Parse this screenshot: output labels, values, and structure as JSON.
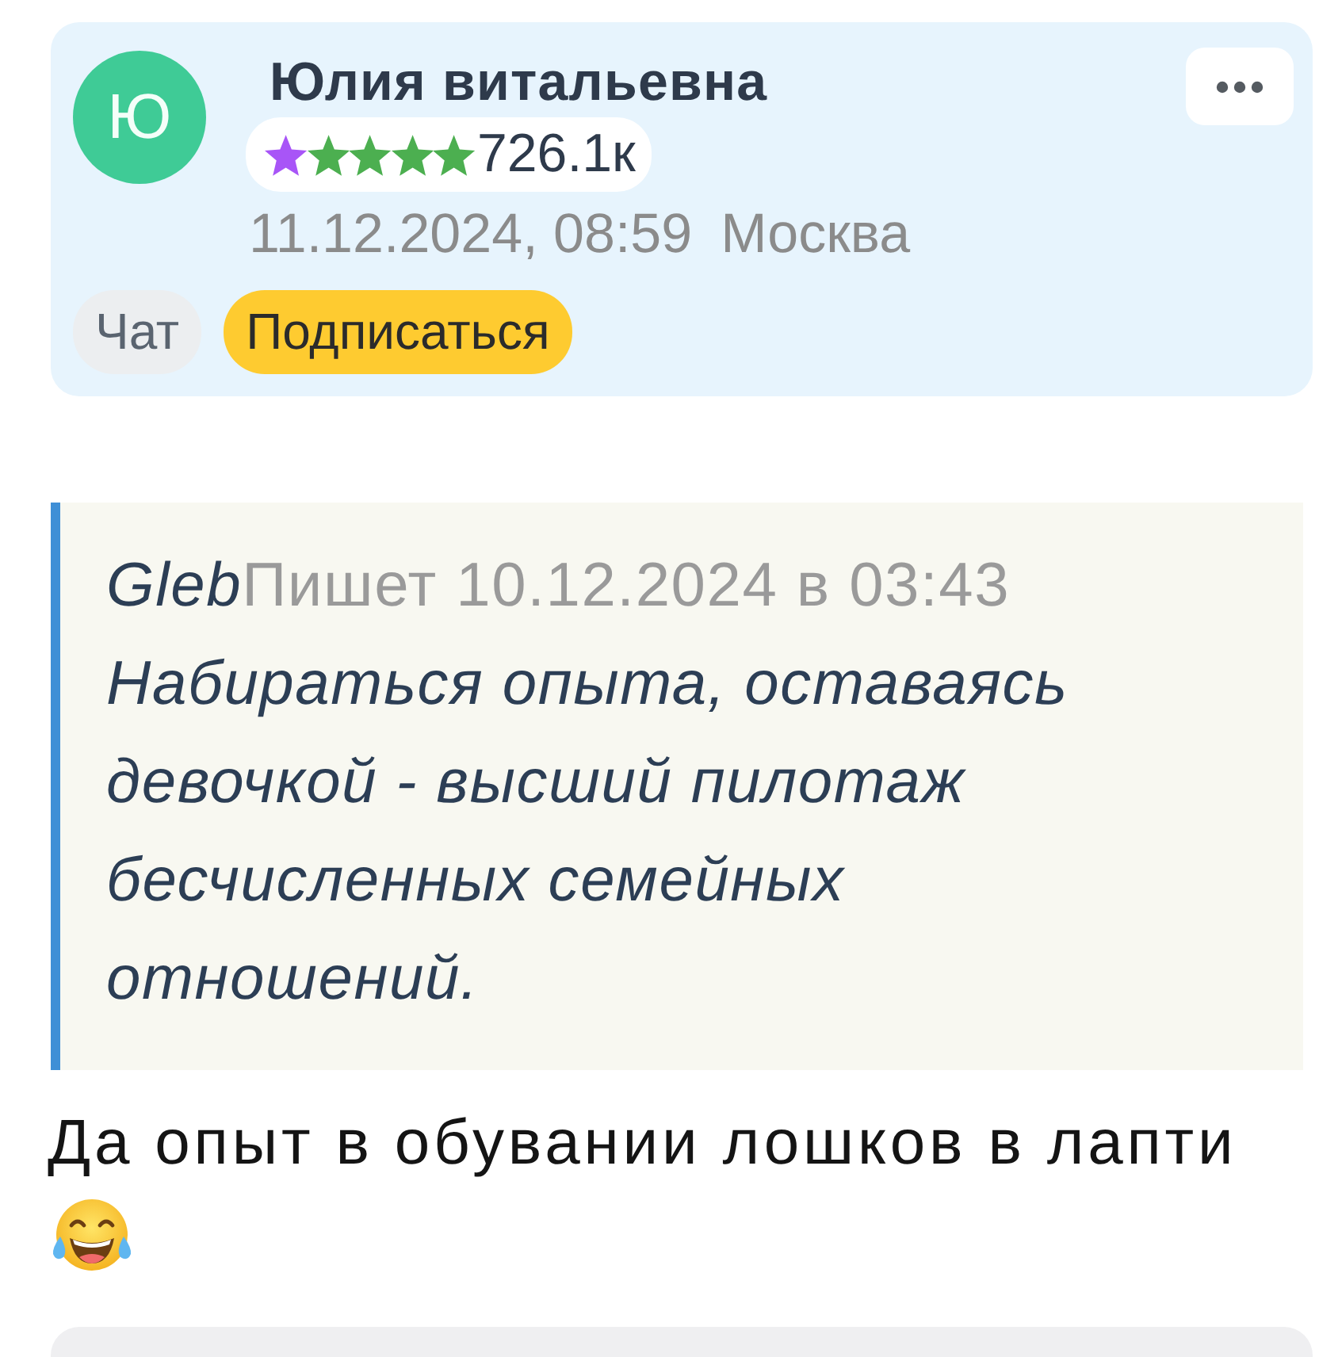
{
  "author": {
    "avatar_initial": "Ю",
    "name": "Юлия витальевна",
    "rating": {
      "star_items": [
        {
          "color": "#a855f7"
        },
        {
          "color": "#4caf50"
        },
        {
          "color": "#4caf50"
        },
        {
          "color": "#4caf50"
        },
        {
          "color": "#4caf50"
        }
      ],
      "count": "726.1к"
    },
    "date": "11.12.2024, 08:59",
    "city": "Москва",
    "buttons": [
      {
        "label": "Чат",
        "kind": "secondary"
      },
      {
        "label": "Подписаться",
        "kind": "primary"
      }
    ]
  },
  "quote": {
    "author": "Gleb",
    "meta": "Пишет 10.12.2024 в 03:43",
    "text": "Набираться опыта, оставаясь девочкой - высший пилотаж бесчисленных семейных отношений."
  },
  "reply": {
    "text": "Да опыт в обувании лошков в лапти"
  }
}
